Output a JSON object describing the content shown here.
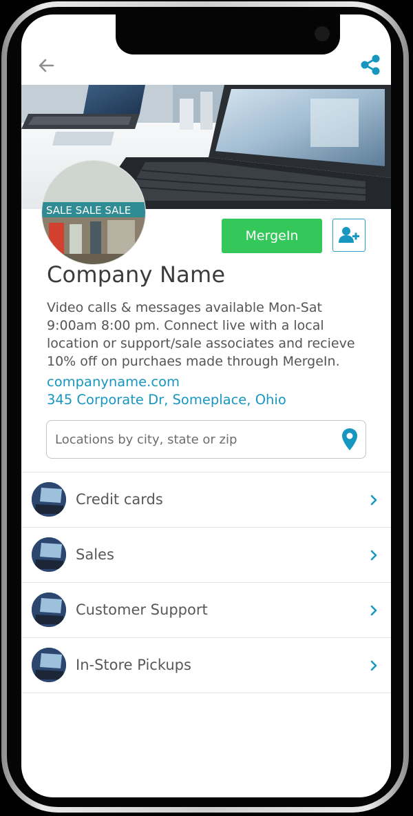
{
  "header": {
    "back_icon": "arrow-left-icon",
    "share_icon": "share-icon"
  },
  "profile": {
    "company_name": "Company Name",
    "mergein_label": "MergeIn",
    "add_contact_icon": "add-user-icon",
    "description": "Video calls & messages available Mon-Sat 9:00am 8:00 pm. Connect live with a local location or support/sale associates and recieve 10% off on purchaes made through MergeIn.",
    "website": "companyname.com",
    "address": "345 Corporate Dr, Someplace, Ohio",
    "avatar_sign_text": "SALE SALE SALE"
  },
  "search": {
    "placeholder": "Locations by city, state or zip",
    "value": "",
    "icon": "map-pin-icon"
  },
  "departments": [
    {
      "label": "Credit cards"
    },
    {
      "label": "Sales"
    },
    {
      "label": "Customer Support"
    },
    {
      "label": "In-Store Pickups"
    }
  ],
  "colors": {
    "accent": "#1797c0",
    "mergein_button": "#34c759",
    "text_dark": "#3b3b3b"
  }
}
